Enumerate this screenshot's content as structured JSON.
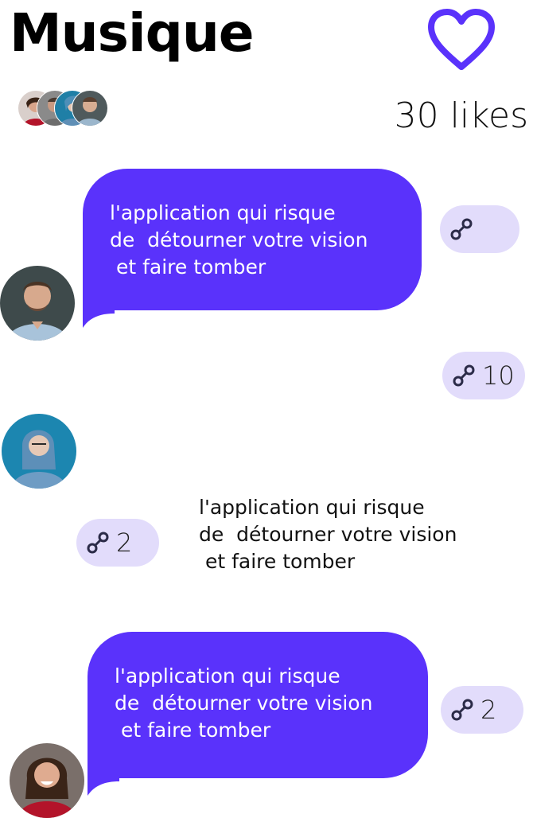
{
  "header": {
    "title": "Musique",
    "likes": "30 likes"
  },
  "colors": {
    "accent": "#5a32fb",
    "chip_bg": "#e2dcfb"
  },
  "messages": [
    {
      "text": "l'application qui risque\nde  détourner votre vision\n et faire tomber",
      "style": "bubble",
      "chip_count": ""
    },
    {
      "text": "",
      "style": "none",
      "chip_count": "10"
    },
    {
      "text": "l'application qui risque\nde  détourner votre vision\n et faire tomber",
      "style": "plain",
      "chip_count": "2"
    },
    {
      "text": "l'application qui risque\nde  détourner votre vision\n et faire tomber",
      "style": "bubble",
      "chip_count": "2"
    }
  ],
  "icons": {
    "like": "heart-icon",
    "share": "link-icon"
  }
}
